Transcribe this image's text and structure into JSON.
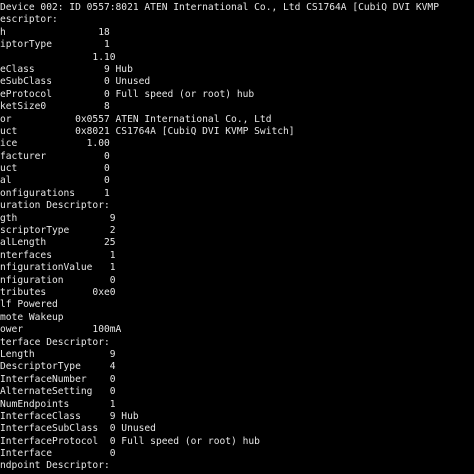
{
  "terminal": {
    "background": "#000000",
    "foreground": "#e6e6e6",
    "lines": [
      "Device 002: ID 0557:8021 ATEN International Co., Ltd CS1764A [CubiQ DVI KVMP",
      "escriptor:",
      "h                18",
      "iptorType         1",
      "                1.10",
      "eClass            9 Hub",
      "eSubClass         0 Unused",
      "eProtocol         0 Full speed (or root) hub",
      "ketSize0          8",
      "or           0x0557 ATEN International Co., Ltd",
      "uct          0x8021 CS1764A [CubiQ DVI KVMP Switch]",
      "ice            1.00",
      "facturer          0",
      "uct               0",
      "al                0",
      "onfigurations     1",
      "uration Descriptor:",
      "gth                9",
      "scriptorType       2",
      "alLength          25",
      "nterfaces          1",
      "nfigurationValue   1",
      "nfiguration        0",
      "tributes        0xe0",
      "lf Powered",
      "mote Wakeup",
      "ower            100mA",
      "terface Descriptor:",
      "Length             9",
      "DescriptorType     4",
      "InterfaceNumber    0",
      "AlternateSetting   0",
      "NumEndpoints       1",
      "InterfaceClass     9 Hub",
      "InterfaceSubClass  0 Unused",
      "InterfaceProtocol  0 Full speed (or root) hub",
      "Interface          0",
      "ndpoint Descriptor:"
    ]
  }
}
